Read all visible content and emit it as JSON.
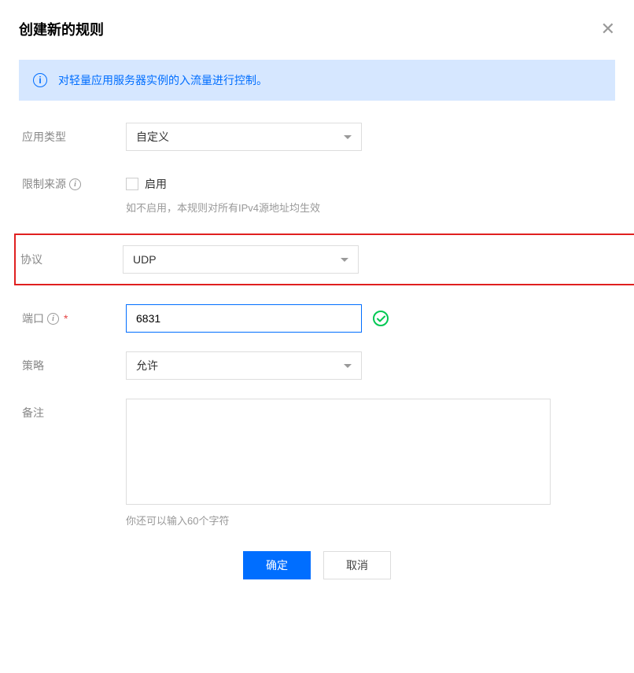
{
  "header": {
    "title": "创建新的规则"
  },
  "banner": {
    "text": "对轻量应用服务器实例的入流量进行控制。"
  },
  "fields": {
    "app_type": {
      "label": "应用类型",
      "value": "自定义"
    },
    "restrict": {
      "label": "限制来源",
      "checkbox_label": "启用",
      "hint": "如不启用，本规则对所有IPv4源地址均生效"
    },
    "protocol": {
      "label": "协议",
      "value": "UDP"
    },
    "port": {
      "label": "端口",
      "value": "6831"
    },
    "policy": {
      "label": "策略",
      "value": "允许"
    },
    "remarks": {
      "label": "备注",
      "hint": "你还可以输入60个字符"
    }
  },
  "actions": {
    "confirm": "确定",
    "cancel": "取消"
  }
}
